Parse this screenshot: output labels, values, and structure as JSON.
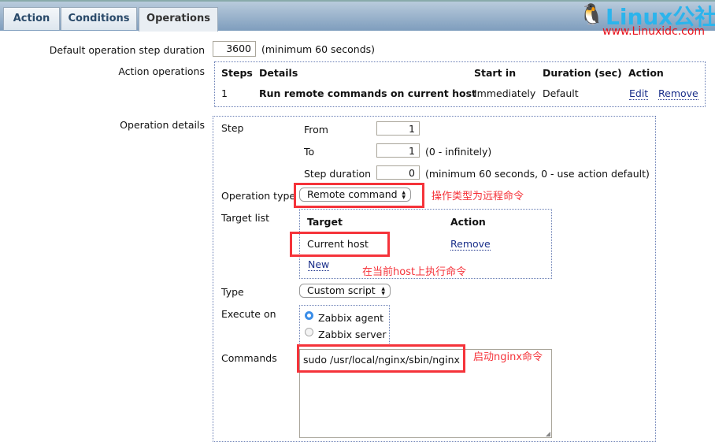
{
  "tabs": [
    {
      "label": "Action"
    },
    {
      "label": "Conditions"
    },
    {
      "label": "Operations",
      "active": true
    }
  ],
  "logo": {
    "text": "Linux公社",
    "url": "www.Linuxidc.com"
  },
  "default_step": {
    "label": "Default operation step duration",
    "value": "3600",
    "hint": "(minimum 60 seconds)"
  },
  "action_operations": {
    "label": "Action operations",
    "headers": [
      "Steps",
      "Details",
      "Start in",
      "Duration (sec)",
      "Action"
    ],
    "rows": [
      {
        "steps": "1",
        "details": "Run remote commands on current host",
        "start_in": "Immediately",
        "duration": "Default",
        "edit": "Edit",
        "remove": "Remove"
      }
    ]
  },
  "operation_details": {
    "label": "Operation details",
    "step": {
      "label": "Step",
      "from_label": "From",
      "from": "1",
      "to_label": "To",
      "to": "1",
      "to_hint": "(0 - infinitely)",
      "duration_label": "Step duration",
      "duration": "0",
      "duration_hint": "(minimum 60 seconds, 0 - use action default)"
    },
    "operation_type": {
      "label": "Operation type",
      "value": "Remote command"
    },
    "target_list": {
      "label": "Target list",
      "headers": [
        "Target",
        "Action"
      ],
      "rows": [
        {
          "target": "Current host",
          "action": "Remove"
        }
      ],
      "new": "New"
    },
    "type": {
      "label": "Type",
      "value": "Custom script"
    },
    "execute_on": {
      "label": "Execute on",
      "options": [
        "Zabbix agent",
        "Zabbix server"
      ],
      "selected": "Zabbix agent"
    },
    "commands": {
      "label": "Commands",
      "value": "sudo /usr/local/nginx/sbin/nginx"
    }
  },
  "annotations": {
    "op_type": "操作类型为远程命令",
    "target": "在当前host上执行命令",
    "commands": "启动nginx命令"
  },
  "colors": {
    "annotation": "#f5333a",
    "link": "#1a2f8a"
  }
}
